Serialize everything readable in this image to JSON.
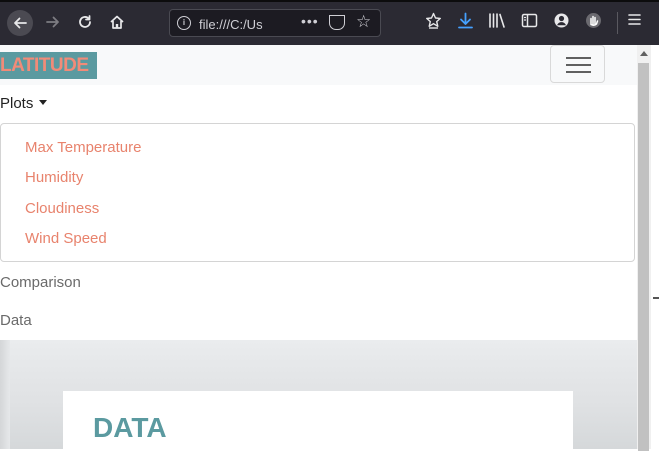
{
  "browser": {
    "url": "file:///C:/Us",
    "menu_dots": "•••"
  },
  "navbar": {
    "brand": "LATITUDE"
  },
  "menu": {
    "dropdown_label": "Plots",
    "dropdown_items": [
      "Max Temperature",
      "Humidity",
      "Cloudiness",
      "Wind Speed"
    ],
    "comparison": "Comparison",
    "data": "Data"
  },
  "hero": {
    "title": "DATA"
  },
  "colors": {
    "brand_bg": "#5b9aa0",
    "brand_text": "#f28b78",
    "link": "#e8836d",
    "heading": "#5b9aa0"
  }
}
